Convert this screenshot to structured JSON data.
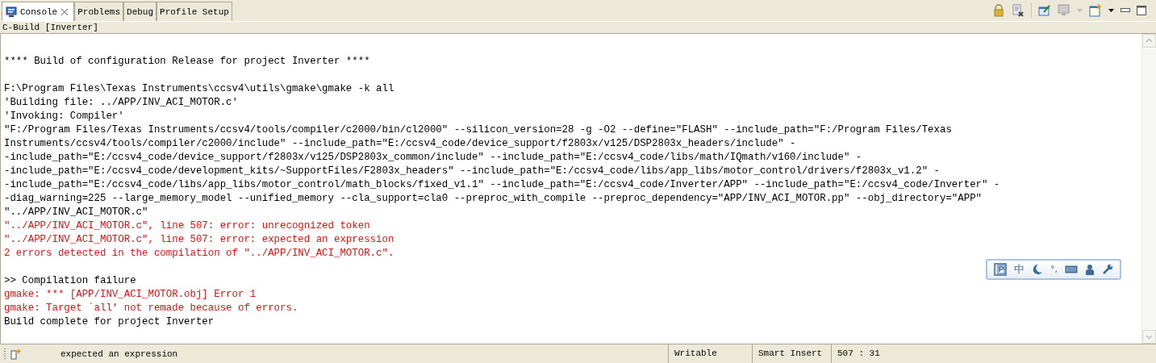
{
  "tabs": [
    {
      "label": "Console",
      "selected": true,
      "closable": true
    },
    {
      "label": "Problems",
      "selected": false,
      "closable": false
    },
    {
      "label": "Debug",
      "selected": false,
      "closable": false
    },
    {
      "label": "Profile Setup",
      "selected": false,
      "closable": false
    }
  ],
  "console_title": "C-Build [Inverter]",
  "console_lines": [
    {
      "kind": "blank"
    },
    {
      "kind": "normal",
      "text": "**** Build of configuration Release for project Inverter ****"
    },
    {
      "kind": "blank"
    },
    {
      "kind": "normal",
      "text": "F:\\Program Files\\Texas Instruments\\ccsv4\\utils\\gmake\\gmake -k all"
    },
    {
      "kind": "normal",
      "text": "'Building file: ../APP/INV_ACI_MOTOR.c'"
    },
    {
      "kind": "normal",
      "text": "'Invoking: Compiler'"
    },
    {
      "kind": "normal",
      "text": "\"F:/Program Files/Texas Instruments/ccsv4/tools/compiler/c2000/bin/cl2000\" --silicon_version=28 -g -O2 --define=\"FLASH\" --include_path=\"F:/Program Files/Texas"
    },
    {
      "kind": "normal",
      "text": "Instruments/ccsv4/tools/compiler/c2000/include\" --include_path=\"E:/ccsv4_code/device_support/f2803x/v125/DSP2803x_headers/include\" -"
    },
    {
      "kind": "normal",
      "text": "-include_path=\"E:/ccsv4_code/device_support/f2803x/v125/DSP2803x_common/include\" --include_path=\"E:/ccsv4_code/libs/math/IQmath/v160/include\" -"
    },
    {
      "kind": "normal",
      "text": "-include_path=\"E:/ccsv4_code/development_kits/~SupportFiles/F2803x_headers\" --include_path=\"E:/ccsv4_code/libs/app_libs/motor_control/drivers/f2803x_v1.2\" -"
    },
    {
      "kind": "normal",
      "text": "-include_path=\"E:/ccsv4_code/libs/app_libs/motor_control/math_blocks/fixed_v1.1\" --include_path=\"E:/ccsv4_code/Inverter/APP\" --include_path=\"E:/ccsv4_code/Inverter\" -"
    },
    {
      "kind": "normal",
      "text": "-diag_warning=225 --large_memory_model --unified_memory --cla_support=cla0 --preproc_with_compile --preproc_dependency=\"APP/INV_ACI_MOTOR.pp\" --obj_directory=\"APP\""
    },
    {
      "kind": "normal",
      "text": "\"../APP/INV_ACI_MOTOR.c\""
    },
    {
      "kind": "error",
      "text": "\"../APP/INV_ACI_MOTOR.c\", line 507: error: unrecognized token"
    },
    {
      "kind": "error",
      "text": "\"../APP/INV_ACI_MOTOR.c\", line 507: error: expected an expression"
    },
    {
      "kind": "error",
      "text": "2 errors detected in the compilation of \"../APP/INV_ACI_MOTOR.c\"."
    },
    {
      "kind": "blank"
    },
    {
      "kind": "normal",
      "text": ">> Compilation failure"
    },
    {
      "kind": "error",
      "text": "gmake: *** [APP/INV_ACI_MOTOR.obj] Error 1"
    },
    {
      "kind": "error",
      "text": "gmake: Target `all' not remade because of errors."
    },
    {
      "kind": "normal",
      "text": "Build complete for project Inverter"
    }
  ],
  "ime_toolbar": {
    "mode": "中",
    "punctuation": "°,"
  },
  "status_bar": {
    "message": "expected an expression",
    "fields": [
      "Writable",
      "Smart Insert",
      "507 : 31"
    ]
  }
}
